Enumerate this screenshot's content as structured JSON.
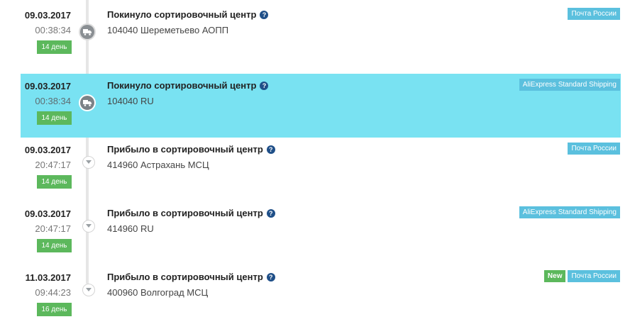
{
  "events": [
    {
      "date": "09.03.2017",
      "time": "00:38:34",
      "day": "14 день",
      "status": "Покинуло сортировочный центр",
      "location": "104040 Шереметьево АОПП",
      "carrier": "Почта России",
      "is_new": false,
      "highlighted": false,
      "marker": "truck-icon"
    },
    {
      "date": "09.03.2017",
      "time": "00:38:34",
      "day": "14 день",
      "status": "Покинуло сортировочный центр",
      "location": "104040 RU",
      "carrier": "AliExpress Standard Shipping",
      "is_new": false,
      "highlighted": true,
      "marker": "truck-icon"
    },
    {
      "date": "09.03.2017",
      "time": "20:47:17",
      "day": "14 день",
      "status": "Прибыло в сортировочный центр",
      "location": "414960 Астрахань МСЦ",
      "carrier": "Почта России",
      "is_new": false,
      "highlighted": false,
      "marker": "chevron-down-icon"
    },
    {
      "date": "09.03.2017",
      "time": "20:47:17",
      "day": "14 день",
      "status": "Прибыло в сортировочный центр",
      "location": "414960 RU",
      "carrier": "AliExpress Standard Shipping",
      "is_new": false,
      "highlighted": false,
      "marker": "chevron-down-icon"
    },
    {
      "date": "11.03.2017",
      "time": "09:44:23",
      "day": "16 день",
      "status": "Прибыло в сортировочный центр",
      "location": "400960 Волгоград МСЦ",
      "carrier": "Почта России",
      "is_new": true,
      "new_label": "New",
      "highlighted": false,
      "marker": "chevron-down-icon"
    }
  ],
  "help_glyph": "?"
}
